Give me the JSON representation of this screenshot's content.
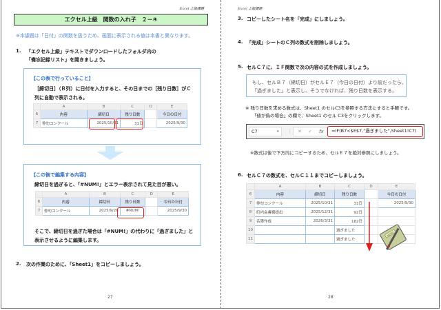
{
  "left": {
    "header": "Excel 上級課題",
    "title": "エクセル上級　関数の入れ子　２－④",
    "notice": "※本課題は「日付」の関数を扱うため、画面に表示される値は本書と異なります。",
    "step1": {
      "num": "1.",
      "line1": "「エクセル上級」テキストでダウンロードしたフォルダ内の",
      "line2": "「備忘記録リスト」を開きましょう。"
    },
    "box1": {
      "heading": "【この表で行っていること】",
      "line1": "［締切日］（Ｂ列）に日付を入力すると、その日までの［残り日数］がＣ",
      "line2": "列に自動で表示される。"
    },
    "box2": {
      "heading": "【この後で編集する内容】",
      "line1": "締切日を過ぎると、「#NUM!」とエラー表示されて見た目が悪い。",
      "line2": "そこで、締切日を過ぎた場合は「#NUM!」の代わりに「過ぎました」と",
      "line3": "表示させるように編集します。"
    },
    "sheet1": {
      "cols": [
        "A",
        "B",
        "C",
        "D",
        "E"
      ],
      "rows": [
        "6",
        "7"
      ],
      "headers": [
        "内容",
        "締切日",
        "残り日数",
        "",
        "今日の日付"
      ],
      "row7": [
        "俳句コンクール",
        "2025/10/31",
        "31日",
        "",
        "2025/9/30"
      ]
    },
    "sheet2": {
      "cols": [
        "A",
        "B",
        "C",
        "D",
        "E"
      ],
      "rows": [
        "6",
        "7"
      ],
      "headers": [
        "内容",
        "締切日",
        "残り日数",
        "",
        "今日の日付"
      ],
      "row7": [
        "俳句コンクール",
        "2025/9/28",
        "#NUM!",
        "",
        "2025/9/30"
      ]
    },
    "step2": {
      "num": "2.",
      "text": "次の作業のために、「Sheet1」をコピーしましょう。"
    },
    "page_number": "27"
  },
  "right": {
    "header": "Excel 上級課題",
    "step3": {
      "num": "3.",
      "text": "コピーしたシート名を「完成」にしましょう。"
    },
    "step4": {
      "num": "4.",
      "text": "「完成」シートのＣ列の数式を削除しましょう。"
    },
    "step5": {
      "num": "5.",
      "text": "セルＣ７に、ＩＦ関数で次の内容の式を作成しましょう。"
    },
    "condition": {
      "line1": "もし、セルＢ７（締切日）がセルＥ７（今日の日付）より前だったら、",
      "line2": "「過ぎました」と表示し、そうでなければ、残り日数を表示する。"
    },
    "tip": {
      "line1": "※ 残り日数を求める数式は、Sheet1 のセルC3を参照する方法にすると手軽です。",
      "line2": "「値が偽の場合」の欄で、Sheet1 のセル C3をクリックします。"
    },
    "formula_bar": {
      "name_box": "C7",
      "cancel": "✕",
      "enter": "✓",
      "fx": "fx",
      "formula": "=IF(B7<$E$7,\"過ぎました\",Sheet1!C7)"
    },
    "note": "※数式は後で下方向にコピーするため、セルＥ７を絶対参照にしましょう。",
    "step6": {
      "num": "6.",
      "text": "セルＣ７の数式を、セルＣ１１までコピーしましょう。"
    },
    "sheet3": {
      "cols": [
        "A",
        "B",
        "C",
        "D",
        "E"
      ],
      "headers": [
        "内容",
        "締切日",
        "残り日数",
        "",
        "今日の日付"
      ],
      "rows": [
        {
          "n": "7",
          "a": "俳句コンクール",
          "b": "2025/10/31",
          "c": "31日",
          "e": "2025/9/30"
        },
        {
          "n": "8",
          "a": "町内会書類提出",
          "b": "2025/12/31",
          "c": "92日",
          "e": ""
        },
        {
          "n": "9",
          "a": "名簿作成",
          "b": "2026/3/31",
          "c": "182日",
          "e": ""
        },
        {
          "n": "10",
          "a": "",
          "b": "",
          "c": "過ぎました",
          "e": ""
        },
        {
          "n": "11",
          "a": "",
          "b": "",
          "c": "過ぎました",
          "e": ""
        }
      ],
      "memo_label": "MEMO"
    },
    "page_number": "28"
  },
  "colors": {
    "title_bg": "#ccf5c8",
    "accent_blue": "#2f6fc0",
    "highlight_red": "#e0201c"
  }
}
